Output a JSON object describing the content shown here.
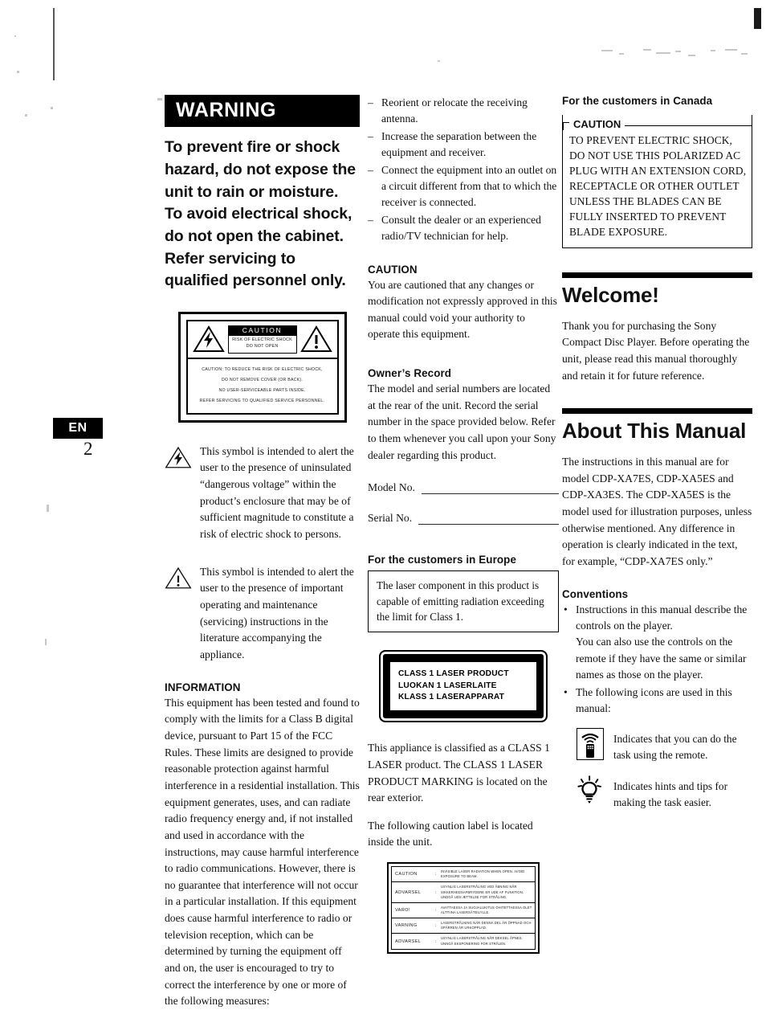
{
  "page": {
    "language_tab": "EN",
    "number": "2"
  },
  "warning": {
    "heading": "WARNING",
    "lines": [
      "To prevent fire or shock hazard, do not expose the unit to rain or moisture.",
      "To avoid electrical shock, do not open the cabinet. Refer servicing to qualified personnel only."
    ]
  },
  "caution_symbol_box": {
    "caution_label": "CAUTION",
    "risk_lines": [
      "RISK OF ELECTRIC SHOCK",
      "DO NOT OPEN"
    ],
    "bottom_lines": [
      "CAUTION: TO REDUCE THE RISK OF ELECTRIC SHOCK,",
      "DO NOT REMOVE COVER (OR BACK).",
      "NO USER-SERVICEABLE PARTS INSIDE.",
      "REFER SERVICING TO QUALIFIED SERVICE PERSONNEL."
    ]
  },
  "symbols": [
    {
      "icon": "lightning-bolt-triangle-icon",
      "text": "This symbol is intended to alert the user to the presence of uninsulated “dangerous voltage” within the product’s enclosure that may be of sufficient magnitude to constitute a risk of electric shock to persons."
    },
    {
      "icon": "exclamation-triangle-icon",
      "text": "This symbol is intended to alert the user to the presence of important operating and maintenance (servicing) instructions in the literature accompanying the appliance."
    }
  ],
  "information": {
    "heading": "INFORMATION",
    "body": "This equipment has been tested and found to comply with the limits for a Class B digital device, pursuant to Part 15 of the FCC Rules. These limits are designed to provide reasonable protection against harmful interference in a residential installation. This equipment generates, uses, and can radiate radio frequency energy and, if not installed and used in accordance with the instructions, may cause harmful interference to radio communications. However, there is no guarantee that interference will not occur in a particular installation. If this equipment does cause harmful interference to radio or television reception, which can be determined by turning the equipment off and on, the user is encouraged to try to correct the interference by one or more of the following measures:"
  },
  "measures": [
    "Reorient or relocate the receiving antenna.",
    "Increase the separation between the equipment and receiver.",
    "Connect the equipment into an outlet on a circuit different from that to which the receiver is connected.",
    "Consult the dealer or an experienced radio/TV technician for help."
  ],
  "caution_fcc": {
    "heading": "CAUTION",
    "body": "You are cautioned that any changes or modification not expressly approved in this manual could void your authority to operate this equipment."
  },
  "owners_record": {
    "heading": "Owner’s Record",
    "body": "The model and serial numbers are located at the rear of the unit. Record the serial number in the space provided below. Refer to them whenever you call upon your Sony dealer regarding this product.",
    "fields": [
      {
        "label": "Model No.",
        "value": ""
      },
      {
        "label": "Serial No.",
        "value": ""
      }
    ]
  },
  "europe": {
    "heading": "For the customers in Europe",
    "note_box": "The laser component in this product is capable of emitting radiation exceeding the limit for Class 1.",
    "laser_label_lines": [
      "CLASS 1 LASER PRODUCT",
      "LUOKAN 1 LASERLAITE",
      "KLASS 1 LASERAPPARAT"
    ],
    "classification_text": "This appliance is classified as a CLASS 1 LASER product. The CLASS 1 LASER PRODUCT MARKING is located on the rear exterior.",
    "label_location_text": "The following caution label is located inside the unit."
  },
  "multilingual_label": {
    "rows": [
      {
        "lang": "CAUTION",
        "message": "INVISIBLE LASER RADIATION WHEN OPEN. AVOID EXPOSURE TO BEAM."
      },
      {
        "lang": "ADVARSEL",
        "message": "USYNLIG LASERSTRÅLING VED ÅBNING NÅR SIKKERHEDSAFBRYDERE ER UDE AF FUNKTION. UNDGÅ UDS ÆTTELSE FOR STRÅLING."
      },
      {
        "lang": "VARO!",
        "message": "AVATTAESSA JA SUOJALUKITUS OHITETTAESSA OLET ALTTIINA LASERSÄTEILYLLE."
      },
      {
        "lang": "VARNING",
        "message": "LASERSTRÅLNING NÄR DENNA DEL ÄR ÖPPNAD OCH SPÄRREN ÄR URKOPPLAD."
      },
      {
        "lang": "ADVARSEL",
        "message": "USYNLIG LASERSTRÅLING NÅR DEKSEL ÅPNES. UNNGÅ EKSPONERING FOR STRÅLEN."
      }
    ]
  },
  "canada": {
    "heading": "For the customers in Canada",
    "legend": "CAUTION",
    "body": "TO PREVENT ELECTRIC SHOCK, DO NOT USE THIS POLARIZED AC PLUG WITH AN EXTENSION CORD, RECEPTACLE OR OTHER OUTLET UNLESS THE BLADES CAN BE FULLY INSERTED TO PREVENT BLADE EXPOSURE."
  },
  "welcome": {
    "title": "Welcome!",
    "body": "Thank you for purchasing the Sony Compact Disc Player. Before operating the unit, please read this manual thoroughly and retain it for future reference."
  },
  "about_manual": {
    "title": "About This Manual",
    "body": "The instructions in this manual are for model CDP-XA7ES, CDP-XA5ES and CDP-XA3ES. The CDP-XA5ES is the model used for illustration purposes, unless otherwise mentioned. Any difference in operation is clearly indicated in the text, for example, “CDP-XA7ES only.”",
    "conventions_heading": "Conventions",
    "bullets": [
      {
        "main": "Instructions in this manual describe the controls on the player.",
        "sub": "You can also use the controls on the remote if they have the same or similar names as those on the player."
      },
      {
        "main": "The following icons are used in this manual:",
        "sub": ""
      }
    ],
    "icons": [
      {
        "icon": "remote-control-icon",
        "text": "Indicates that you can do the task using the remote."
      },
      {
        "icon": "lightbulb-tip-icon",
        "text": "Indicates hints and tips for making the task easier."
      }
    ]
  }
}
